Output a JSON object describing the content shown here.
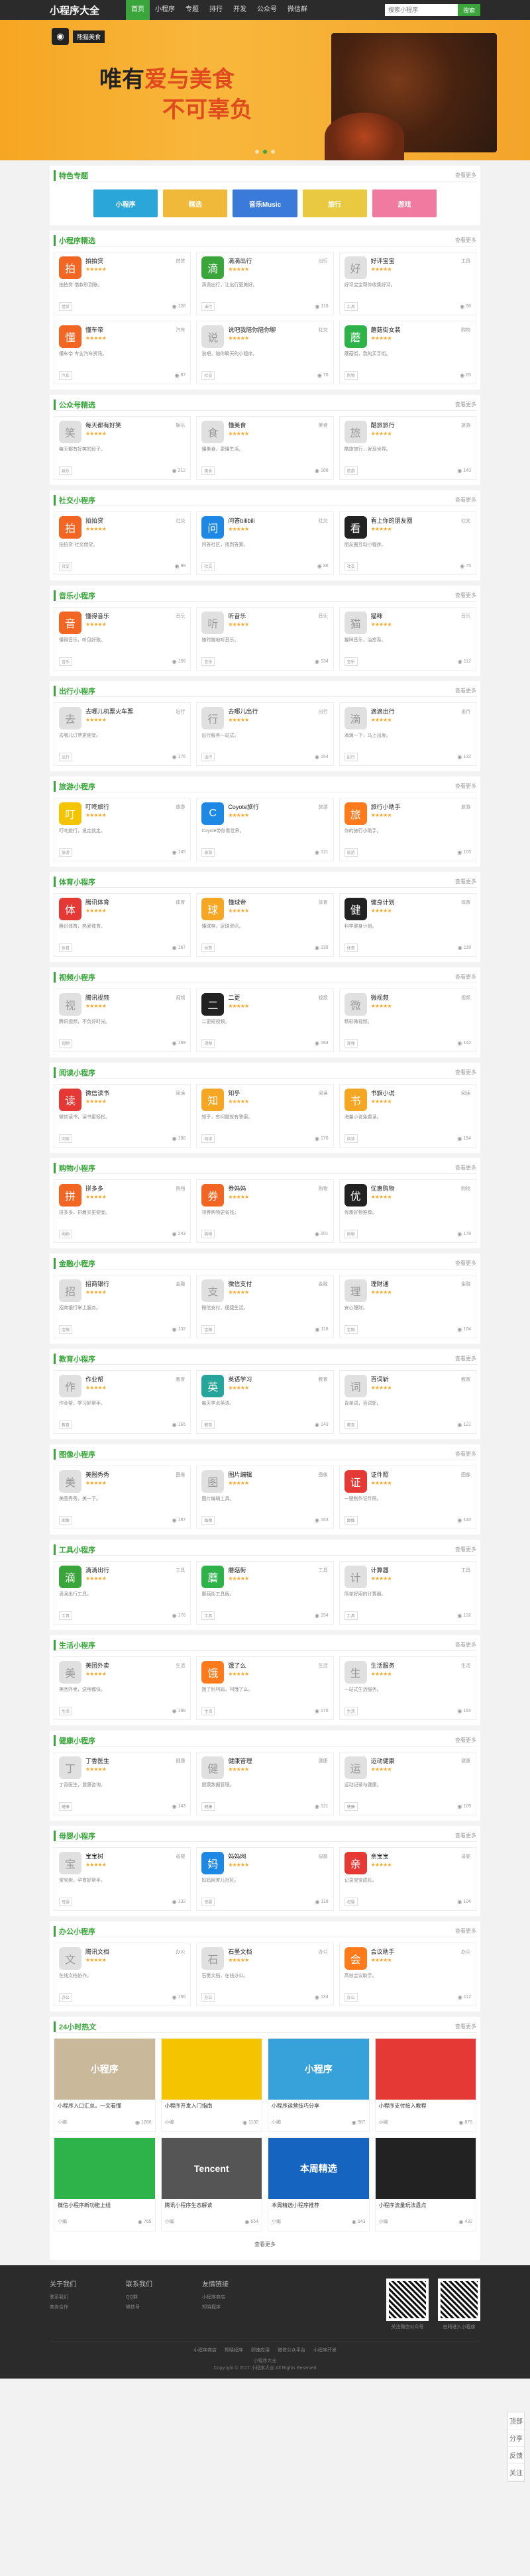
{
  "header": {
    "logo": "小程序大全",
    "nav": [
      "首页",
      "小程序",
      "专题",
      "排行",
      "开发",
      "公众号",
      "微信群"
    ],
    "search_placeholder": "搜索小程序",
    "search_button": "搜索"
  },
  "banner": {
    "brand": "熊猫美食",
    "slogan_prefix": "唯有",
    "slogan_hl": "爱与美食",
    "slogan_line2": "不可辜负"
  },
  "more_label": "查看更多",
  "feature": {
    "title": "特色专题",
    "items": [
      {
        "label": "小程序",
        "color": "#2aa7d8"
      },
      {
        "label": "精选",
        "color": "#f1b93a"
      },
      {
        "label": "音乐Music",
        "color": "#3a7ad8"
      },
      {
        "label": "旅行",
        "color": "#e8c93f"
      },
      {
        "label": "游戏",
        "color": "#f07aa0"
      }
    ]
  },
  "sections": [
    {
      "title": "小程序精选",
      "cards": [
        {
          "name": "拍拍贷",
          "tag": "借贷",
          "desc": "拍拍贷·借款秒到账。",
          "chip": "借贷",
          "views": "128",
          "icon": "#f26522",
          "glyph": "拍"
        },
        {
          "name": "滴滴出行",
          "tag": "出行",
          "desc": "滴滴出行，让出行更美好。",
          "chip": "出行",
          "views": "116",
          "icon": "#3aa53a",
          "glyph": "滴"
        },
        {
          "name": "好评宝宝",
          "tag": "工具",
          "desc": "好评宝宝帮你收集好评。",
          "chip": "工具",
          "views": "98",
          "icon": "#e0e0e0",
          "glyph": "好"
        },
        {
          "name": "懂车帝",
          "tag": "汽车",
          "desc": "懂车帝·专业汽车资讯。",
          "chip": "汽车",
          "views": "87",
          "icon": "#f26522",
          "glyph": "懂"
        },
        {
          "name": "说吧我陪你陪你聊",
          "tag": "社交",
          "desc": "说吧，陪你聊天的小程序。",
          "chip": "社交",
          "views": "76",
          "icon": "#e0e0e0",
          "glyph": "说"
        },
        {
          "name": "蘑菇街女装",
          "tag": "购物",
          "desc": "蘑菇街，我的买手街。",
          "chip": "购物",
          "views": "65",
          "icon": "#2db34a",
          "glyph": "蘑"
        }
      ]
    },
    {
      "title": "公众号精选",
      "cards": [
        {
          "name": "每天都有好笑",
          "tag": "娱乐",
          "desc": "每天都有好笑的段子。",
          "chip": "娱乐",
          "views": "212",
          "icon": "#e0e0e0",
          "glyph": "笑"
        },
        {
          "name": "懂美食",
          "tag": "美食",
          "desc": "懂美食，更懂生活。",
          "chip": "美食",
          "views": "188",
          "icon": "#e0e0e0",
          "glyph": "食"
        },
        {
          "name": "酷旅旅行",
          "tag": "旅游",
          "desc": "酷旅旅行，发现世界。",
          "chip": "旅游",
          "views": "143",
          "icon": "#e0e0e0",
          "glyph": "旅"
        }
      ]
    },
    {
      "title": "社交小程序",
      "cards": [
        {
          "name": "拍拍贷",
          "tag": "社交",
          "desc": "拍拍贷·社交借贷。",
          "chip": "社交",
          "views": "98",
          "icon": "#f26522",
          "glyph": "拍"
        },
        {
          "name": "问答bilibili",
          "tag": "社交",
          "desc": "问答社区，找到答案。",
          "chip": "社交",
          "views": "86",
          "icon": "#1e88e5",
          "glyph": "问"
        },
        {
          "name": "看上你的朋友圈",
          "tag": "社交",
          "desc": "朋友圈互动小程序。",
          "chip": "社交",
          "views": "75",
          "icon": "#222222",
          "glyph": "看"
        }
      ]
    },
    {
      "title": "音乐小程序",
      "cards": [
        {
          "name": "懂得音乐",
          "tag": "音乐",
          "desc": "懂得音乐，听见好歌。",
          "chip": "音乐",
          "views": "156",
          "icon": "#f26522",
          "glyph": "音"
        },
        {
          "name": "听音乐",
          "tag": "音乐",
          "desc": "随时随地听音乐。",
          "chip": "音乐",
          "views": "134",
          "icon": "#e0e0e0",
          "glyph": "听"
        },
        {
          "name": "猫咪",
          "tag": "音乐",
          "desc": "猫咪音乐，治愈系。",
          "chip": "音乐",
          "views": "112",
          "icon": "#e0e0e0",
          "glyph": "猫"
        }
      ]
    },
    {
      "title": "出行小程序",
      "cards": [
        {
          "name": "去哪儿机票火车票",
          "tag": "出行",
          "desc": "去哪儿订票更便宜。",
          "chip": "出行",
          "views": "176",
          "icon": "#e0e0e0",
          "glyph": "去"
        },
        {
          "name": "去哪儿出行",
          "tag": "出行",
          "desc": "出行服务一站式。",
          "chip": "出行",
          "views": "154",
          "icon": "#e0e0e0",
          "glyph": "行"
        },
        {
          "name": "滴滴出行",
          "tag": "出行",
          "desc": "滴滴一下，马上出发。",
          "chip": "出行",
          "views": "132",
          "icon": "#e0e0e0",
          "glyph": "滴"
        }
      ]
    },
    {
      "title": "旅游小程序",
      "cards": [
        {
          "name": "叮咚旅行",
          "tag": "旅游",
          "desc": "叮咚旅行，说走就走。",
          "chip": "旅游",
          "views": "145",
          "icon": "#f5c400",
          "glyph": "叮"
        },
        {
          "name": "Coyote旅行",
          "tag": "旅游",
          "desc": "Coyote带你看世界。",
          "chip": "旅游",
          "views": "121",
          "icon": "#1e88e5",
          "glyph": "C"
        },
        {
          "name": "旅行小助手",
          "tag": "旅游",
          "desc": "你的旅行小助手。",
          "chip": "旅游",
          "views": "103",
          "icon": "#ff7a1a",
          "glyph": "旅"
        }
      ]
    },
    {
      "title": "体育小程序",
      "cards": [
        {
          "name": "腾讯体育",
          "tag": "体育",
          "desc": "腾讯体育，热爱体育。",
          "chip": "体育",
          "views": "167",
          "icon": "#e53935",
          "glyph": "体"
        },
        {
          "name": "懂球帝",
          "tag": "体育",
          "desc": "懂球帝，足球资讯。",
          "chip": "体育",
          "views": "139",
          "icon": "#f5a623",
          "glyph": "球"
        },
        {
          "name": "健身计划",
          "tag": "体育",
          "desc": "科学健身计划。",
          "chip": "体育",
          "views": "118",
          "icon": "#222222",
          "glyph": "健"
        }
      ]
    },
    {
      "title": "视频小程序",
      "cards": [
        {
          "name": "腾讯视频",
          "tag": "视频",
          "desc": "腾讯视频，不负好时光。",
          "chip": "视频",
          "views": "189",
          "icon": "#e0e0e0",
          "glyph": "视"
        },
        {
          "name": "二更",
          "tag": "视频",
          "desc": "二更短视频。",
          "chip": "视频",
          "views": "164",
          "icon": "#222222",
          "glyph": "二"
        },
        {
          "name": "微视频",
          "tag": "视频",
          "desc": "精彩微视频。",
          "chip": "视频",
          "views": "142",
          "icon": "#e0e0e0",
          "glyph": "微"
        }
      ]
    },
    {
      "title": "阅读小程序",
      "cards": [
        {
          "name": "微信读书",
          "tag": "阅读",
          "desc": "微信读书，读书更轻松。",
          "chip": "阅读",
          "views": "198",
          "icon": "#e53935",
          "glyph": "读"
        },
        {
          "name": "知乎",
          "tag": "阅读",
          "desc": "知乎，有问题就有答案。",
          "chip": "阅读",
          "views": "176",
          "icon": "#f5a623",
          "glyph": "知"
        },
        {
          "name": "书旗小说",
          "tag": "阅读",
          "desc": "海量小说免费读。",
          "chip": "阅读",
          "views": "154",
          "icon": "#f5a623",
          "glyph": "书"
        }
      ]
    },
    {
      "title": "购物小程序",
      "cards": [
        {
          "name": "拼多多",
          "tag": "购物",
          "desc": "拼多多，拼着买更便宜。",
          "chip": "购物",
          "views": "243",
          "icon": "#f26522",
          "glyph": "拼"
        },
        {
          "name": "券妈妈",
          "tag": "购物",
          "desc": "领券购物更省钱。",
          "chip": "购物",
          "views": "201",
          "icon": "#f26522",
          "glyph": "券"
        },
        {
          "name": "优惠购物",
          "tag": "购物",
          "desc": "优惠好物推荐。",
          "chip": "购物",
          "views": "178",
          "icon": "#222222",
          "glyph": "优"
        }
      ]
    },
    {
      "title": "金融小程序",
      "cards": [
        {
          "name": "招商银行",
          "tag": "金融",
          "desc": "招商银行掌上服务。",
          "chip": "金融",
          "views": "132",
          "icon": "#e0e0e0",
          "glyph": "招"
        },
        {
          "name": "微信支付",
          "tag": "金融",
          "desc": "微信支付，便捷生活。",
          "chip": "金融",
          "views": "118",
          "icon": "#e0e0e0",
          "glyph": "支"
        },
        {
          "name": "理财通",
          "tag": "金融",
          "desc": "安心理财。",
          "chip": "金融",
          "views": "104",
          "icon": "#e0e0e0",
          "glyph": "理"
        }
      ]
    },
    {
      "title": "教育小程序",
      "cards": [
        {
          "name": "作业帮",
          "tag": "教育",
          "desc": "作业帮，学习好帮手。",
          "chip": "教育",
          "views": "165",
          "icon": "#e0e0e0",
          "glyph": "作"
        },
        {
          "name": "英语学习",
          "tag": "教育",
          "desc": "每天学点英语。",
          "chip": "教育",
          "views": "143",
          "icon": "#26a69a",
          "glyph": "英"
        },
        {
          "name": "百词斩",
          "tag": "教育",
          "desc": "背单词，百词斩。",
          "chip": "教育",
          "views": "121",
          "icon": "#e0e0e0",
          "glyph": "词"
        }
      ]
    },
    {
      "title": "图像小程序",
      "cards": [
        {
          "name": "美图秀秀",
          "tag": "图像",
          "desc": "美图秀秀，美一下。",
          "chip": "图像",
          "views": "187",
          "icon": "#e0e0e0",
          "glyph": "美"
        },
        {
          "name": "图片编辑",
          "tag": "图像",
          "desc": "图片编辑工具。",
          "chip": "图像",
          "views": "163",
          "icon": "#e0e0e0",
          "glyph": "图"
        },
        {
          "name": "证件照",
          "tag": "图像",
          "desc": "一键制作证件照。",
          "chip": "图像",
          "views": "140",
          "icon": "#e53935",
          "glyph": "证"
        }
      ]
    },
    {
      "title": "工具小程序",
      "cards": [
        {
          "name": "滴滴出行",
          "tag": "工具",
          "desc": "滴滴出行工具。",
          "chip": "工具",
          "views": "176",
          "icon": "#3aa53a",
          "glyph": "滴"
        },
        {
          "name": "蘑菇街",
          "tag": "工具",
          "desc": "蘑菇街工具版。",
          "chip": "工具",
          "views": "154",
          "icon": "#2db34a",
          "glyph": "蘑"
        },
        {
          "name": "计算器",
          "tag": "工具",
          "desc": "简单好用的计算器。",
          "chip": "工具",
          "views": "132",
          "icon": "#e0e0e0",
          "glyph": "计"
        }
      ]
    },
    {
      "title": "生活小程序",
      "cards": [
        {
          "name": "美团外卖",
          "tag": "生活",
          "desc": "美团外卖，送啥都快。",
          "chip": "生活",
          "views": "198",
          "icon": "#e0e0e0",
          "glyph": "美"
        },
        {
          "name": "饿了么",
          "tag": "生活",
          "desc": "饿了别叫妈，叫饿了么。",
          "chip": "生活",
          "views": "176",
          "icon": "#ff7a1a",
          "glyph": "饿"
        },
        {
          "name": "生活服务",
          "tag": "生活",
          "desc": "一站式生活服务。",
          "chip": "生活",
          "views": "154",
          "icon": "#e0e0e0",
          "glyph": "生"
        }
      ]
    },
    {
      "title": "健康小程序",
      "cards": [
        {
          "name": "丁香医生",
          "tag": "健康",
          "desc": "丁香医生，健康咨询。",
          "chip": "健康",
          "views": "143",
          "icon": "#e0e0e0",
          "glyph": "丁"
        },
        {
          "name": "健康管理",
          "tag": "健康",
          "desc": "健康数据管理。",
          "chip": "健康",
          "views": "121",
          "icon": "#e0e0e0",
          "glyph": "健"
        },
        {
          "name": "运动健康",
          "tag": "健康",
          "desc": "运动记录与健康。",
          "chip": "健康",
          "views": "109",
          "icon": "#e0e0e0",
          "glyph": "运"
        }
      ]
    },
    {
      "title": "母婴小程序",
      "cards": [
        {
          "name": "宝宝树",
          "tag": "母婴",
          "desc": "宝宝树，孕育好帮手。",
          "chip": "母婴",
          "views": "132",
          "icon": "#e0e0e0",
          "glyph": "宝"
        },
        {
          "name": "妈妈网",
          "tag": "母婴",
          "desc": "妈妈网育儿社区。",
          "chip": "母婴",
          "views": "118",
          "icon": "#1e88e5",
          "glyph": "妈"
        },
        {
          "name": "亲宝宝",
          "tag": "母婴",
          "desc": "记录宝宝成长。",
          "chip": "母婴",
          "views": "104",
          "icon": "#e53935",
          "glyph": "亲"
        }
      ]
    },
    {
      "title": "办公小程序",
      "cards": [
        {
          "name": "腾讯文档",
          "tag": "办公",
          "desc": "在线文档协作。",
          "chip": "办公",
          "views": "156",
          "icon": "#e0e0e0",
          "glyph": "文"
        },
        {
          "name": "石墨文档",
          "tag": "办公",
          "desc": "石墨文档，在线办公。",
          "chip": "办公",
          "views": "134",
          "icon": "#e0e0e0",
          "glyph": "石"
        },
        {
          "name": "会议助手",
          "tag": "办公",
          "desc": "高效会议助手。",
          "chip": "办公",
          "views": "112",
          "icon": "#ff7a1a",
          "glyph": "会"
        }
      ]
    }
  ],
  "articles": {
    "title": "24小时热文",
    "items": [
      {
        "title": "小程序入口汇总，一文看懂",
        "author": "小编",
        "views": "1286",
        "color": "#c9b89a",
        "label": "小程序"
      },
      {
        "title": "小程序开发入门指南",
        "author": "小编",
        "views": "1132",
        "color": "#f5c400",
        "label": ""
      },
      {
        "title": "小程序运营技巧分享",
        "author": "小编",
        "views": "987",
        "color": "#37a2da",
        "label": "小程序"
      },
      {
        "title": "小程序支付接入教程",
        "author": "小编",
        "views": "876",
        "color": "#e53935",
        "label": ""
      },
      {
        "title": "微信小程序新功能上线",
        "author": "小编",
        "views": "765",
        "color": "#2db34a",
        "label": ""
      },
      {
        "title": "腾讯小程序生态解读",
        "author": "小编",
        "views": "654",
        "color": "#555555",
        "label": "Tencent"
      },
      {
        "title": "本周精选小程序推荐",
        "author": "小编",
        "views": "543",
        "color": "#1565c0",
        "label": "本周精选"
      },
      {
        "title": "小程序流量玩法盘点",
        "author": "小编",
        "views": "432",
        "color": "#222222",
        "label": ""
      }
    ]
  },
  "load_more": "查看更多",
  "footer": {
    "cols": [
      {
        "title": "关于我们",
        "items": [
          "联系我们",
          "商务合作"
        ]
      },
      {
        "title": "联系我们",
        "items": [
          "QQ群",
          "微信号"
        ]
      },
      {
        "title": "友情链接",
        "items": [
          "小程序商店",
          "知晓程序"
        ]
      }
    ],
    "qr_caption": [
      "关注微信公众号",
      "扫码进入小程序"
    ],
    "friend_links": [
      "小程序商店",
      "知晓程序",
      "即速应用",
      "微信公众平台",
      "小程序开发"
    ],
    "copyright1": "小程序大全",
    "copyright2": "Copyright © 2017 小程序大全 All Rights Reserved"
  },
  "sidetools": [
    "顶部",
    "分享",
    "反馈",
    "关注"
  ]
}
